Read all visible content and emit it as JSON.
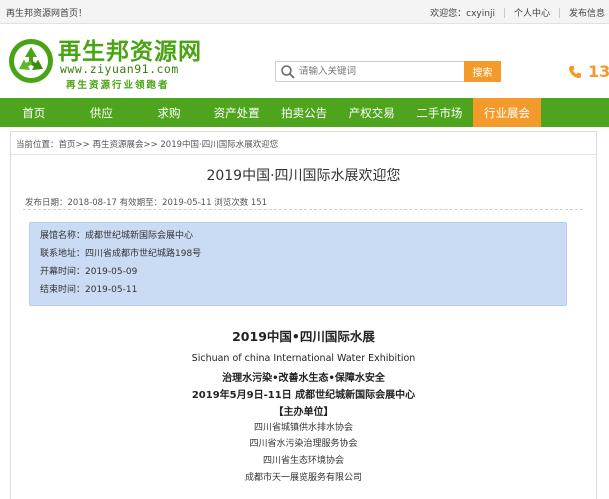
{
  "topbar": {
    "welcome": "再生邦资源网首页！",
    "greeting": "欢迎您：cxyinji",
    "user_center": "个人中心",
    "post_info": "发布信息"
  },
  "header": {
    "logo_title": "再生邦资源网",
    "logo_url": "www.ziyuan91.com",
    "logo_slogan": "再生资源行业领跑者",
    "search_placeholder": "请输入关键词",
    "search_button": "搜索",
    "phone_partial": "13"
  },
  "nav": {
    "items": [
      {
        "label": "首页"
      },
      {
        "label": "供应"
      },
      {
        "label": "求购"
      },
      {
        "label": "资产处置"
      },
      {
        "label": "拍卖公告"
      },
      {
        "label": "产权交易"
      },
      {
        "label": "二手市场"
      },
      {
        "label": "行业展会"
      }
    ]
  },
  "article": {
    "breadcrumb": "当前位置：首页>> 再生资源展会>> 2019中国·四川国际水展欢迎您",
    "title": "2019中国·四川国际水展欢迎您",
    "meta": "发布日期：2018-08-17 有效期至：2019-05-11 浏览次数 151",
    "info": {
      "venue": "展馆名称：成都世纪城新国际会展中心",
      "address": "联系地址：四川省成都市世纪城路198号",
      "start": "开幕时间：2019-05-09",
      "end": "结束时间：2019-05-11"
    },
    "content": {
      "title": "2019中国•四川国际水展",
      "english": "Sichuan of china  International Water Exhibition",
      "slogan": "治理水污染•改善水生态•保障水安全",
      "date_place": "2019年5月9日-11日 成都世纪城新国际会展中心",
      "host_header": "【主办单位】",
      "hosts": [
        "四川省城镇供水排水协会",
        "四川省水污染治理服务协会",
        "四川省生态环境协会",
        "成都市天一展览服务有限公司"
      ]
    }
  },
  "colors": {
    "green": "#4ea51d",
    "orange": "#f39a2b",
    "info_box": "#c9dcf4"
  }
}
